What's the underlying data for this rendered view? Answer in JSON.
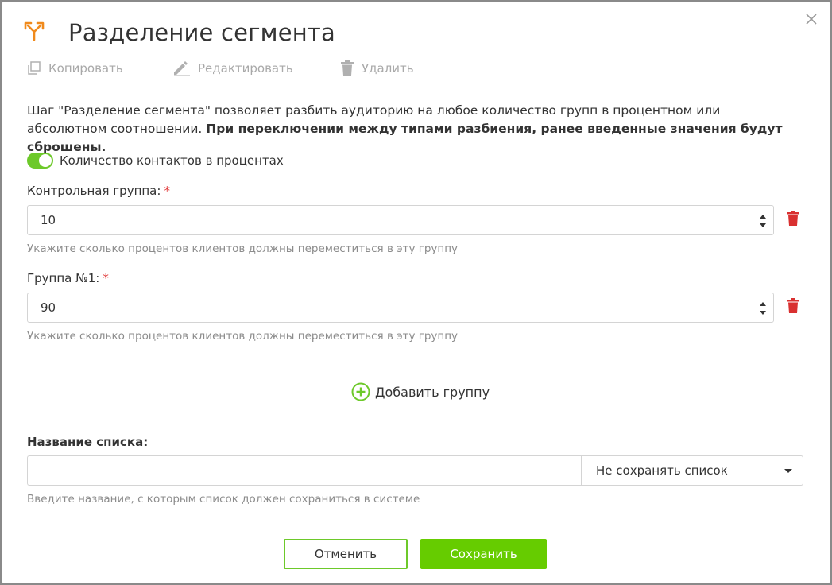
{
  "dialog": {
    "title": "Разделение сегмента",
    "title_icon": "split-arrows-icon",
    "close_icon": "close-icon",
    "accent_color": "#f08a1c"
  },
  "toolbar": {
    "copy_label": "Копировать",
    "edit_label": "Редактировать",
    "delete_label": "Удалить"
  },
  "description": {
    "normal": "Шаг \"Разделение сегмента\" позволяет разбить аудиторию на любое количество групп в процентном или абсолютном соотношении. ",
    "bold": "При переключении между типами разбиения, ранее введенные значения будут сброшены."
  },
  "toggle": {
    "label": "Количество контактов в процентах",
    "on": true,
    "color": "#6dc92a"
  },
  "groups": [
    {
      "label": "Контрольная группа:",
      "required_mark": "*",
      "value": "10",
      "hint": "Укажите сколько процентов клиентов должны переместиться в эту группу"
    },
    {
      "label": "Группа №1:",
      "required_mark": "*",
      "value": "90",
      "hint": "Укажите сколько процентов клиентов должны переместиться в эту группу"
    }
  ],
  "add_group_label": "Добавить группу",
  "list": {
    "label": "Название списка:",
    "input_value": "",
    "select_value": "Не сохранять список",
    "hint": "Введите название, с которым список должен сохраниться в системе"
  },
  "buttons": {
    "cancel": "Отменить",
    "save": "Сохранить",
    "primary_color": "#66cc00"
  }
}
